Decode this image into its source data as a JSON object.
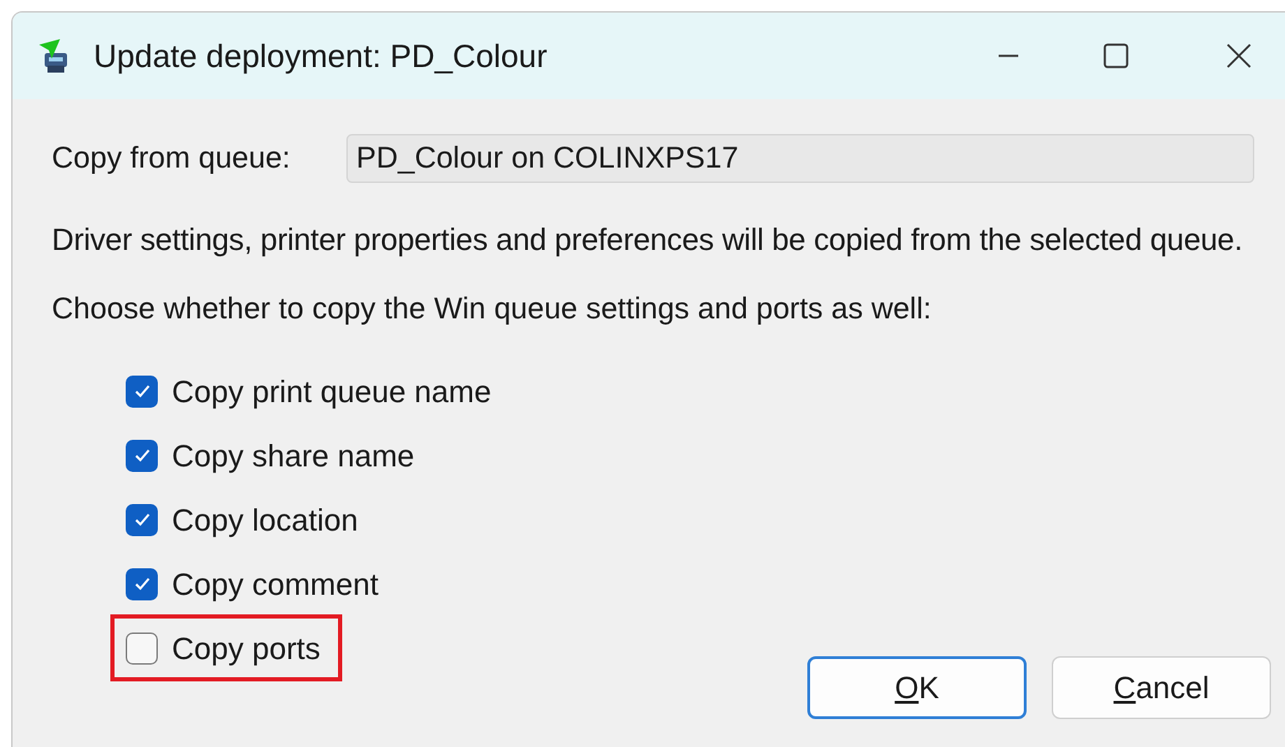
{
  "window": {
    "title": "Update deployment: PD_Colour"
  },
  "copy_from": {
    "label": "Copy from queue:",
    "value": "PD_Colour on COLINXPS17"
  },
  "description": "Driver settings, printer properties and preferences will be copied from the selected queue.",
  "prompt": "Choose whether to copy the Win queue settings and ports as well:",
  "options": [
    {
      "label": "Copy print queue name",
      "checked": true,
      "highlighted": false
    },
    {
      "label": "Copy share name",
      "checked": true,
      "highlighted": false
    },
    {
      "label": "Copy location",
      "checked": true,
      "highlighted": false
    },
    {
      "label": "Copy comment",
      "checked": true,
      "highlighted": false
    },
    {
      "label": "Copy ports",
      "checked": false,
      "highlighted": true
    }
  ],
  "buttons": [
    {
      "label": "OK",
      "default": true,
      "access_key_underlined": true
    },
    {
      "label": "Cancel",
      "default": false,
      "access_key_underlined": true
    }
  ]
}
